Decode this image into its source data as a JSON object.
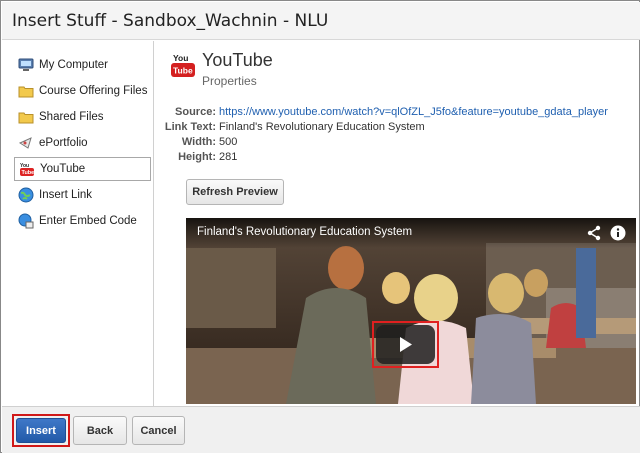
{
  "window": {
    "title": "Insert Stuff - Sandbox_Wachnin - NLU"
  },
  "sidebar": {
    "items": [
      {
        "label": "My Computer",
        "icon": "computer-icon"
      },
      {
        "label": "Course Offering Files",
        "icon": "folder-icon"
      },
      {
        "label": "Shared Files",
        "icon": "folder-icon"
      },
      {
        "label": "ePortfolio",
        "icon": "eportfolio-icon"
      },
      {
        "label": "YouTube",
        "icon": "youtube-icon",
        "selected": true
      },
      {
        "label": "Insert Link",
        "icon": "globe-icon"
      },
      {
        "label": "Enter Embed Code",
        "icon": "embed-code-icon"
      }
    ]
  },
  "main": {
    "logo_text": "You Tube",
    "heading": "YouTube",
    "subheading": "Properties",
    "properties": {
      "source_label": "Source:",
      "source_value": "https://www.youtube.com/watch?v=qlOfZL_J5fo&feature=youtube_gdata_player",
      "linktext_label": "Link Text:",
      "linktext_value": "Finland's Revolutionary Education System",
      "width_label": "Width:",
      "width_value": "500",
      "height_label": "Height:",
      "height_value": "281"
    },
    "refresh_label": "Refresh Preview",
    "video": {
      "title": "Finland's Revolutionary Education System",
      "share_icon": "share-icon",
      "info_icon": "info-icon",
      "play_icon": "play-icon"
    }
  },
  "footer": {
    "insert_label": "Insert",
    "back_label": "Back",
    "cancel_label": "Cancel"
  },
  "colors": {
    "insert_button": "#2c63b4",
    "highlight_border": "#e02020",
    "link": "#2060b0"
  }
}
